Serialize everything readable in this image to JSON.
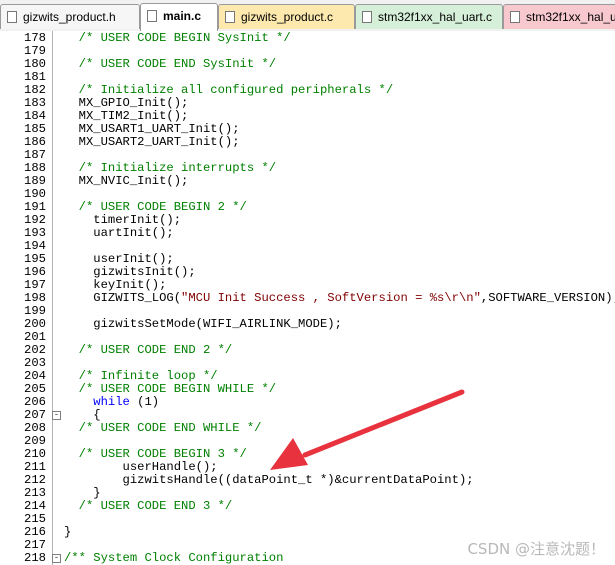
{
  "tabs": [
    {
      "label": "gizwits_product.h",
      "color": "#f6f6f6",
      "active": false
    },
    {
      "label": "main.c",
      "color": "#ffffff",
      "active": true
    },
    {
      "label": "gizwits_product.c",
      "color": "#fde9ae",
      "active": false
    },
    {
      "label": "stm32f1xx_hal_uart.c",
      "color": "#d6efd8",
      "active": false
    },
    {
      "label": "stm32f1xx_hal_u",
      "color": "#f7c9cf",
      "active": false
    }
  ],
  "code_lines": [
    {
      "num": "178",
      "segs": [
        [
          "",
          "  "
        ],
        [
          "cm",
          "/* USER CODE BEGIN SysInit */"
        ]
      ]
    },
    {
      "num": "179",
      "segs": []
    },
    {
      "num": "180",
      "segs": [
        [
          "",
          "  "
        ],
        [
          "cm",
          "/* USER CODE END SysInit */"
        ]
      ]
    },
    {
      "num": "181",
      "segs": []
    },
    {
      "num": "182",
      "segs": [
        [
          "",
          "  "
        ],
        [
          "cm",
          "/* Initialize all configured peripherals */"
        ]
      ]
    },
    {
      "num": "183",
      "segs": [
        [
          "",
          "  MX_GPIO_Init();"
        ]
      ]
    },
    {
      "num": "184",
      "segs": [
        [
          "",
          "  MX_TIM2_Init();"
        ]
      ]
    },
    {
      "num": "185",
      "segs": [
        [
          "",
          "  MX_USART1_UART_Init();"
        ]
      ]
    },
    {
      "num": "186",
      "segs": [
        [
          "",
          "  MX_USART2_UART_Init();"
        ]
      ]
    },
    {
      "num": "187",
      "segs": []
    },
    {
      "num": "188",
      "segs": [
        [
          "",
          "  "
        ],
        [
          "cm",
          "/* Initialize interrupts */"
        ]
      ]
    },
    {
      "num": "189",
      "segs": [
        [
          "",
          "  MX_NVIC_Init();"
        ]
      ]
    },
    {
      "num": "190",
      "segs": []
    },
    {
      "num": "191",
      "segs": [
        [
          "",
          "  "
        ],
        [
          "cm",
          "/* USER CODE BEGIN 2 */"
        ]
      ]
    },
    {
      "num": "192",
      "segs": [
        [
          "",
          "    timerInit();"
        ]
      ]
    },
    {
      "num": "193",
      "segs": [
        [
          "",
          "    uartInit();"
        ]
      ]
    },
    {
      "num": "194",
      "segs": []
    },
    {
      "num": "195",
      "segs": [
        [
          "",
          "    userInit();"
        ]
      ]
    },
    {
      "num": "196",
      "segs": [
        [
          "",
          "    gizwitsInit();"
        ]
      ]
    },
    {
      "num": "197",
      "segs": [
        [
          "",
          "    keyInit();"
        ]
      ]
    },
    {
      "num": "198",
      "segs": [
        [
          "",
          "    GIZWITS_LOG("
        ],
        [
          "st",
          "\"MCU Init Success , SoftVersion = %s\\r\\n\""
        ],
        [
          "",
          ",SOFTWARE_VERSION);"
        ]
      ]
    },
    {
      "num": "199",
      "segs": []
    },
    {
      "num": "200",
      "segs": [
        [
          "",
          "    gizwitsSetMode(WIFI_AIRLINK_MODE);"
        ]
      ]
    },
    {
      "num": "201",
      "segs": []
    },
    {
      "num": "202",
      "segs": [
        [
          "",
          "  "
        ],
        [
          "cm",
          "/* USER CODE END 2 */"
        ]
      ]
    },
    {
      "num": "203",
      "segs": []
    },
    {
      "num": "204",
      "segs": [
        [
          "",
          "  "
        ],
        [
          "cm",
          "/* Infinite loop */"
        ]
      ]
    },
    {
      "num": "205",
      "segs": [
        [
          "",
          "  "
        ],
        [
          "cm",
          "/* USER CODE BEGIN WHILE */"
        ]
      ]
    },
    {
      "num": "206",
      "segs": [
        [
          "",
          "    "
        ],
        [
          "kw",
          "while"
        ],
        [
          "",
          " (1)"
        ]
      ]
    },
    {
      "num": "207",
      "segs": [
        [
          "",
          "    {"
        ]
      ],
      "fold": "-"
    },
    {
      "num": "208",
      "segs": [
        [
          "",
          "  "
        ],
        [
          "cm",
          "/* USER CODE END WHILE */"
        ]
      ]
    },
    {
      "num": "209",
      "segs": []
    },
    {
      "num": "210",
      "segs": [
        [
          "",
          "  "
        ],
        [
          "cm",
          "/* USER CODE BEGIN 3 */"
        ]
      ]
    },
    {
      "num": "211",
      "segs": [
        [
          "",
          "        userHandle();"
        ]
      ]
    },
    {
      "num": "212",
      "segs": [
        [
          "",
          "        gizwitsHandle((dataPoint_t *)&currentDataPoint);"
        ]
      ]
    },
    {
      "num": "213",
      "segs": [
        [
          "",
          "    }"
        ]
      ]
    },
    {
      "num": "214",
      "segs": [
        [
          "",
          "  "
        ],
        [
          "cm",
          "/* USER CODE END 3 */"
        ]
      ]
    },
    {
      "num": "215",
      "segs": []
    },
    {
      "num": "216",
      "segs": [
        [
          "",
          "}"
        ]
      ]
    },
    {
      "num": "217",
      "segs": []
    },
    {
      "num": "218",
      "segs": [
        [
          "cm",
          "/** System Clock Configuration"
        ]
      ],
      "fold": "-"
    }
  ],
  "watermark": "CSDN @注意沈题！",
  "arrow_color": "#e8333f"
}
